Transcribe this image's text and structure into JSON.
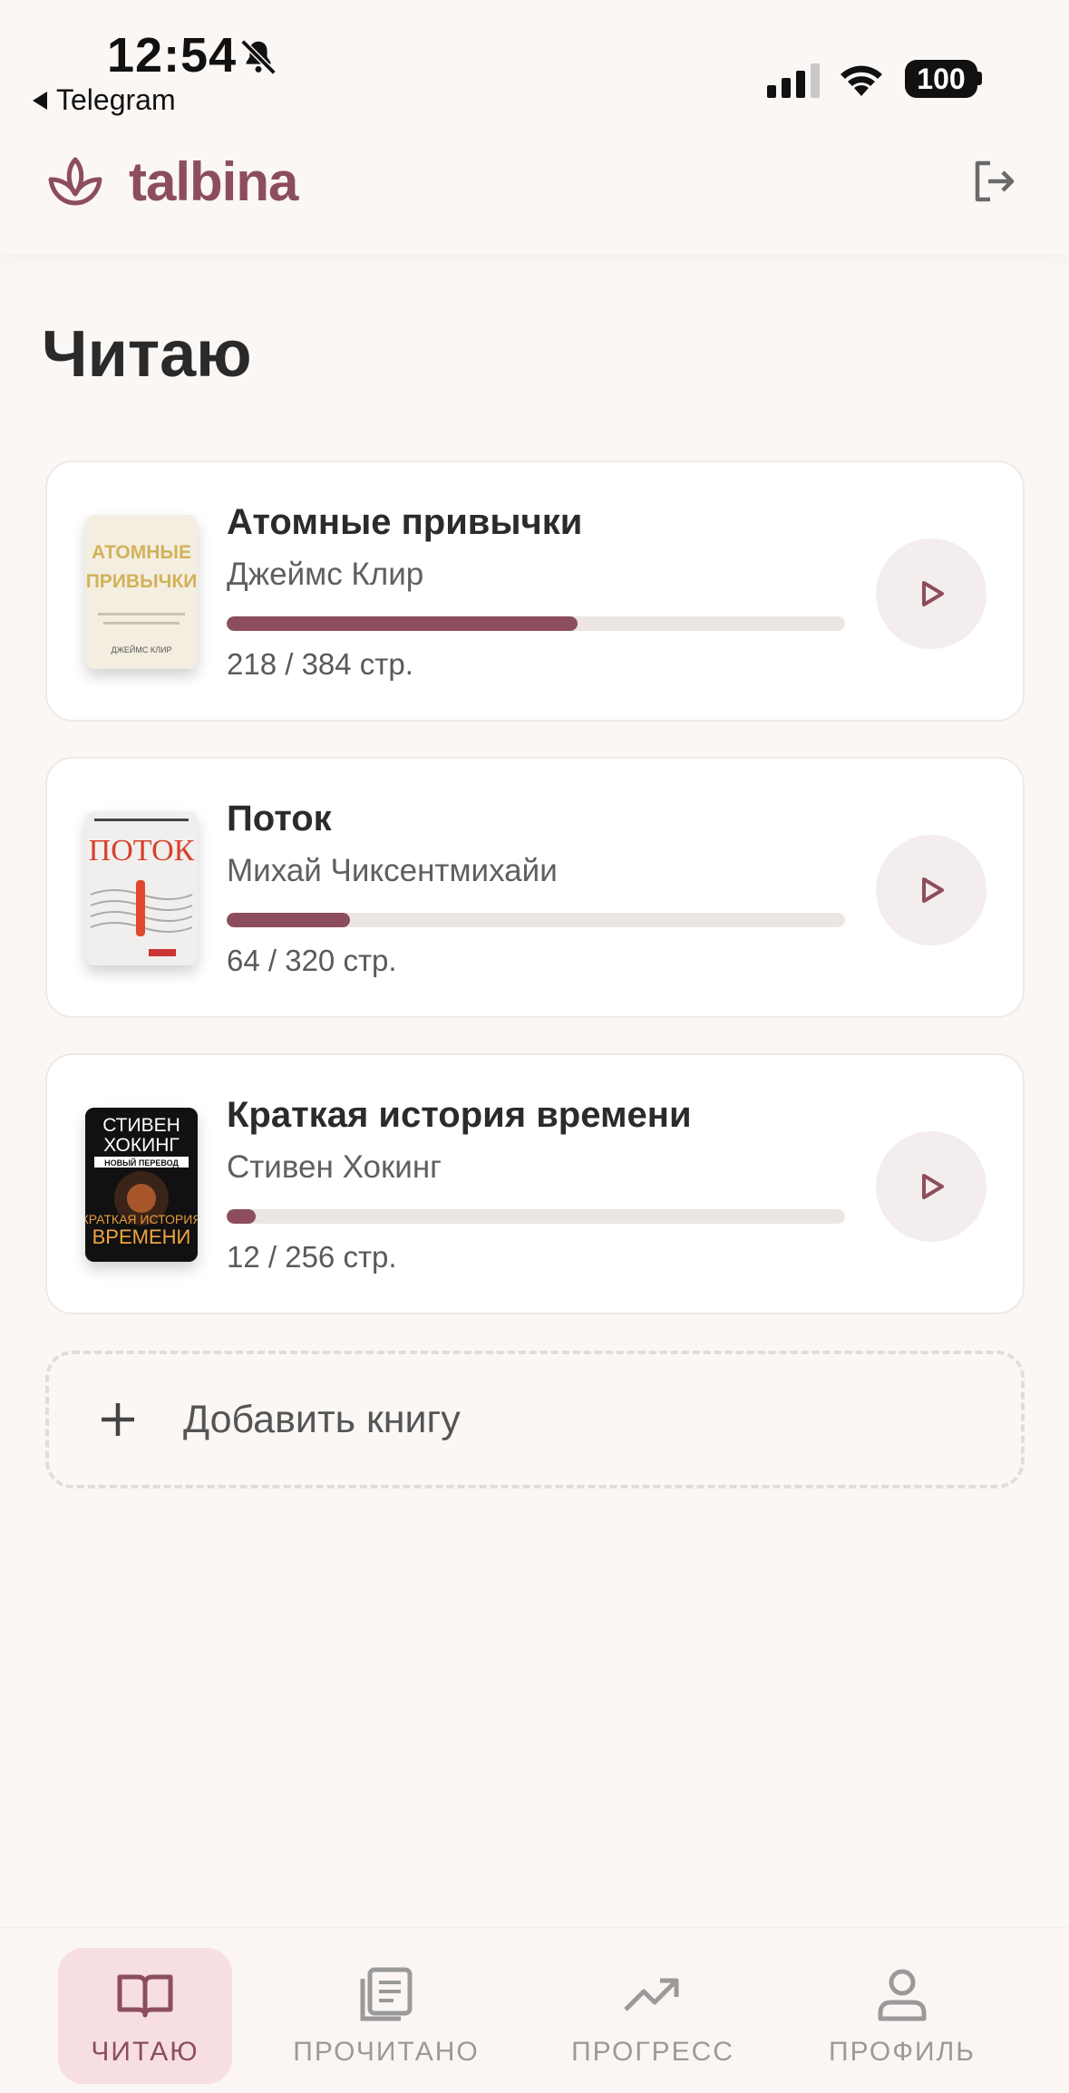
{
  "status_bar": {
    "time": "12:54",
    "back_app": "Telegram",
    "battery": "100"
  },
  "header": {
    "logo_text": "talbina"
  },
  "page": {
    "title": "Читаю"
  },
  "books": [
    {
      "title": "Атомные привычки",
      "author": "Джеймс Клир",
      "pages": "218 / 384 стр.",
      "progress": 0.568,
      "cover_lines": [
        "АТОМНЫЕ",
        "ПРИВЫЧКИ"
      ],
      "cover_footer": "ДЖЕЙМС КЛИР"
    },
    {
      "title": "Поток",
      "author": "Михай Чиксентмихайи",
      "pages": "64 / 320 стр.",
      "progress": 0.2,
      "cover_lines": [
        "ПОТОК"
      ],
      "cover_footer": ""
    },
    {
      "title": "Краткая история времени",
      "author": "Стивен Хокинг",
      "pages": "12 / 256 стр.",
      "progress": 0.047,
      "cover_lines": [
        "СТИВЕН",
        "ХОКИНГ",
        "НОВЫЙ ПЕРЕВОД",
        "КРАТКАЯ ИСТОРИЯ",
        "ВРЕМЕНИ"
      ],
      "cover_footer": ""
    }
  ],
  "add_book": {
    "label": "Добавить книгу"
  },
  "nav": {
    "items": [
      {
        "label": "ЧИТАЮ",
        "icon": "open-book-icon",
        "active": true
      },
      {
        "label": "ПРОЧИТАНО",
        "icon": "document-list-icon",
        "active": false
      },
      {
        "label": "ПРОГРЕСС",
        "icon": "trend-up-icon",
        "active": false
      },
      {
        "label": "ПРОФИЛЬ",
        "icon": "user-icon",
        "active": false
      }
    ]
  },
  "colors": {
    "accent": "#8c4e5c",
    "background": "#fbf7f5",
    "track": "#ebe6e4",
    "nav_active_bg": "#f7dfe1"
  }
}
